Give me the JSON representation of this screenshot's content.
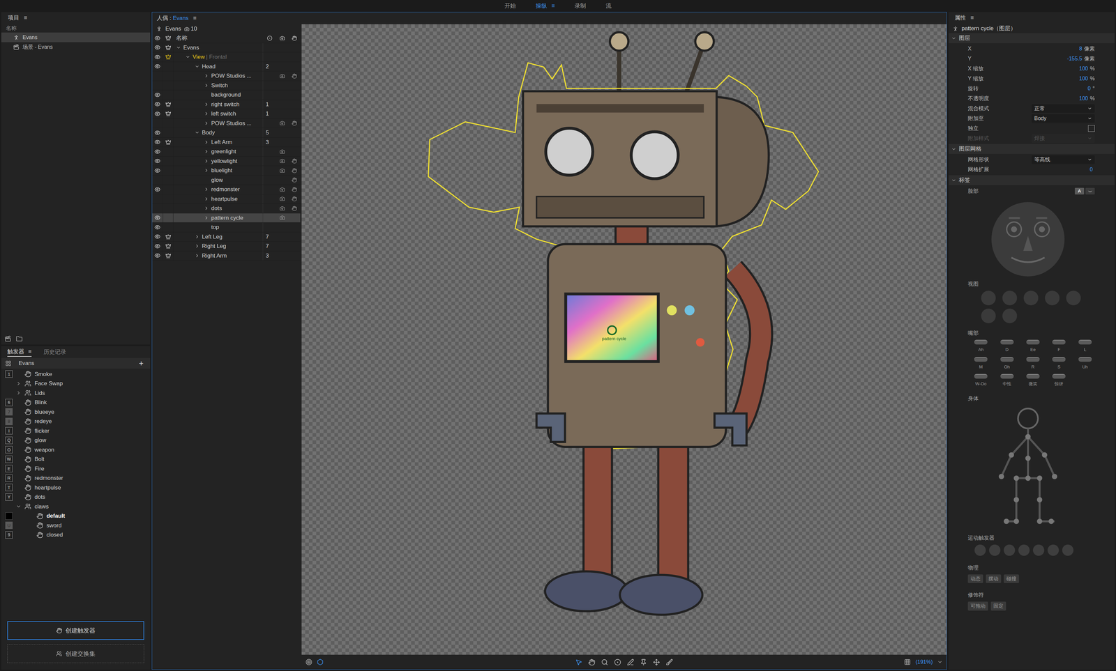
{
  "top_tabs": [
    {
      "label": "开始",
      "selected": false
    },
    {
      "label": "操纵",
      "selected": true
    },
    {
      "label": "录制",
      "selected": false
    },
    {
      "label": "流",
      "selected": false
    }
  ],
  "menu_glyph": "≡",
  "project": {
    "title": "项目",
    "column": "名称",
    "items": [
      {
        "label": "Evans",
        "kind": "puppet",
        "selected": true
      },
      {
        "label": "场景 - Evans",
        "kind": "scene",
        "selected": false
      }
    ]
  },
  "triggers": {
    "tabs": [
      {
        "label": "触发器",
        "selected": true
      },
      {
        "label": "历史记录",
        "selected": false
      }
    ],
    "puppet": "Evans",
    "add": "+",
    "items": [
      {
        "label": "Smoke",
        "kind": "trigger",
        "key": "1",
        "key_state": "outline",
        "child": false,
        "expanded": false
      },
      {
        "label": "Face Swap",
        "kind": "swapset",
        "key": "",
        "key_state": "none",
        "child": false,
        "expanded": false
      },
      {
        "label": "Lids",
        "kind": "swapset",
        "key": "",
        "key_state": "none",
        "child": false,
        "expanded": false
      },
      {
        "label": "Blink",
        "kind": "trigger",
        "key": "6",
        "key_state": "outline",
        "child": false,
        "expanded": false
      },
      {
        "label": "blueeye",
        "kind": "trigger",
        "key": "7",
        "key_state": "dim",
        "child": false,
        "expanded": false
      },
      {
        "label": "redeye",
        "kind": "trigger",
        "key": "8",
        "key_state": "dim",
        "child": false,
        "expanded": false
      },
      {
        "label": "flicker",
        "kind": "trigger",
        "key": "I",
        "key_state": "outline",
        "child": false,
        "expanded": false
      },
      {
        "label": "glow",
        "kind": "trigger",
        "key": "Q",
        "key_state": "outline",
        "child": false,
        "expanded": false
      },
      {
        "label": "weapon",
        "kind": "trigger",
        "key": "O",
        "key_state": "outline",
        "child": false,
        "expanded": false
      },
      {
        "label": "Bolt",
        "kind": "trigger",
        "key": "W",
        "key_state": "outline",
        "child": false,
        "expanded": false
      },
      {
        "label": "Fire",
        "kind": "trigger",
        "key": "E",
        "key_state": "outline",
        "child": false,
        "expanded": false
      },
      {
        "label": "redmonster",
        "kind": "trigger",
        "key": "R",
        "key_state": "outline",
        "child": false,
        "expanded": false
      },
      {
        "label": "heartpulse",
        "kind": "trigger",
        "key": "T",
        "key_state": "outline",
        "child": false,
        "expanded": false
      },
      {
        "label": "dots",
        "kind": "trigger",
        "key": "Y",
        "key_state": "outline",
        "child": false,
        "expanded": false
      },
      {
        "label": "claws",
        "kind": "swapset",
        "key": "",
        "key_state": "none",
        "child": false,
        "expanded": true
      },
      {
        "label": "default",
        "kind": "trigger",
        "key": "",
        "key_state": "filled",
        "child": true,
        "expanded": false,
        "default": true
      },
      {
        "label": "sword",
        "kind": "trigger",
        "key": "U",
        "key_state": "dim",
        "child": true,
        "expanded": false
      },
      {
        "label": "closed",
        "kind": "trigger",
        "key": "9",
        "key_state": "outline",
        "child": true,
        "expanded": false
      }
    ],
    "buttons": [
      {
        "label": "创建触发器",
        "kind": "primary"
      },
      {
        "label": "创建交换集",
        "kind": "dashed"
      }
    ]
  },
  "puppet_panel": {
    "title": "人偶",
    "separator": " : ",
    "puppet": "Evans",
    "root_label": "Evans",
    "root_count": "10",
    "header": "名称",
    "layers": [
      {
        "name": "Evans",
        "suffix": "",
        "count": "",
        "depth": 0,
        "arrow": "expanded",
        "visible": true,
        "crown": "white",
        "selected": false,
        "highlight": false,
        "tagged": false,
        "triggered": false
      },
      {
        "name": "View",
        "suffix": "| Frontal",
        "count": "",
        "depth": 1,
        "arrow": "expanded",
        "visible": true,
        "crown": "yellow",
        "selected": false,
        "highlight": true,
        "tagged": false,
        "triggered": false
      },
      {
        "name": "Head",
        "suffix": "",
        "count": "2",
        "depth": 2,
        "arrow": "expanded",
        "visible": true,
        "crown": "none",
        "selected": false,
        "highlight": false,
        "tagged": false,
        "triggered": false
      },
      {
        "name": "POW Studios ...",
        "suffix": "",
        "count": "",
        "depth": 3,
        "arrow": "collapsed",
        "visible": false,
        "crown": "none",
        "selected": false,
        "highlight": false,
        "tagged": true,
        "triggered": true
      },
      {
        "name": "Switch",
        "suffix": "",
        "count": "",
        "depth": 3,
        "arrow": "collapsed",
        "visible": false,
        "crown": "none",
        "selected": false,
        "highlight": false,
        "tagged": false,
        "triggered": false
      },
      {
        "name": "background",
        "suffix": "",
        "count": "",
        "depth": 3,
        "arrow": "none",
        "visible": true,
        "crown": "none",
        "selected": false,
        "highlight": false,
        "tagged": false,
        "triggered": false
      },
      {
        "name": "right switch",
        "suffix": "",
        "count": "1",
        "depth": 3,
        "arrow": "collapsed",
        "visible": true,
        "crown": "white",
        "selected": false,
        "highlight": false,
        "tagged": false,
        "triggered": false
      },
      {
        "name": "left switch",
        "suffix": "",
        "count": "1",
        "depth": 3,
        "arrow": "collapsed",
        "visible": true,
        "crown": "white",
        "selected": false,
        "highlight": false,
        "tagged": false,
        "triggered": false
      },
      {
        "name": "POW Studios ...",
        "suffix": "",
        "count": "",
        "depth": 3,
        "arrow": "collapsed",
        "visible": false,
        "crown": "none",
        "selected": false,
        "highlight": false,
        "tagged": true,
        "triggered": true
      },
      {
        "name": "Body",
        "suffix": "",
        "count": "5",
        "depth": 2,
        "arrow": "expanded",
        "visible": true,
        "crown": "none",
        "selected": false,
        "highlight": false,
        "tagged": false,
        "triggered": false
      },
      {
        "name": "Left Arm",
        "suffix": "",
        "count": "3",
        "depth": 3,
        "arrow": "collapsed",
        "visible": true,
        "crown": "white",
        "selected": false,
        "highlight": false,
        "tagged": false,
        "triggered": false
      },
      {
        "name": "greenlight",
        "suffix": "",
        "count": "",
        "depth": 3,
        "arrow": "collapsed",
        "visible": true,
        "crown": "none",
        "selected": false,
        "highlight": false,
        "tagged": true,
        "triggered": false
      },
      {
        "name": "yellowlight",
        "suffix": "",
        "count": "",
        "depth": 3,
        "arrow": "collapsed",
        "visible": true,
        "crown": "none",
        "selected": false,
        "highlight": false,
        "tagged": true,
        "triggered": true
      },
      {
        "name": "bluelight",
        "suffix": "",
        "count": "",
        "depth": 3,
        "arrow": "collapsed",
        "visible": true,
        "crown": "none",
        "selected": false,
        "highlight": false,
        "tagged": true,
        "triggered": true
      },
      {
        "name": "glow",
        "suffix": "",
        "count": "",
        "depth": 3,
        "arrow": "none",
        "visible": false,
        "crown": "none",
        "selected": false,
        "highlight": false,
        "tagged": false,
        "triggered": true
      },
      {
        "name": "redmonster",
        "suffix": "",
        "count": "",
        "depth": 3,
        "arrow": "collapsed",
        "visible": true,
        "crown": "none",
        "selected": false,
        "highlight": false,
        "tagged": true,
        "triggered": true
      },
      {
        "name": "heartpulse",
        "suffix": "",
        "count": "",
        "depth": 3,
        "arrow": "collapsed",
        "visible": false,
        "crown": "none",
        "selected": false,
        "highlight": false,
        "tagged": true,
        "triggered": true
      },
      {
        "name": "dots",
        "suffix": "",
        "count": "",
        "depth": 3,
        "arrow": "collapsed",
        "visible": false,
        "crown": "none",
        "selected": false,
        "highlight": false,
        "tagged": true,
        "triggered": true
      },
      {
        "name": "pattern cycle",
        "suffix": "",
        "count": "",
        "depth": 3,
        "arrow": "collapsed",
        "visible": true,
        "crown": "none",
        "selected": true,
        "highlight": false,
        "tagged": true,
        "triggered": false
      },
      {
        "name": "top",
        "suffix": "",
        "count": "",
        "depth": 3,
        "arrow": "none",
        "visible": true,
        "crown": "none",
        "selected": false,
        "highlight": false,
        "tagged": false,
        "triggered": false
      },
      {
        "name": "Left Leg",
        "suffix": "",
        "count": "7",
        "depth": 2,
        "arrow": "collapsed",
        "visible": true,
        "crown": "white",
        "selected": false,
        "highlight": false,
        "tagged": false,
        "triggered": false
      },
      {
        "name": "Right Leg",
        "suffix": "",
        "count": "7",
        "depth": 2,
        "arrow": "collapsed",
        "visible": true,
        "crown": "white",
        "selected": false,
        "highlight": false,
        "tagged": false,
        "triggered": false
      },
      {
        "name": "Right Arm",
        "suffix": "",
        "count": "3",
        "depth": 2,
        "arrow": "collapsed",
        "visible": true,
        "crown": "white",
        "selected": false,
        "highlight": false,
        "tagged": false,
        "triggered": false
      }
    ]
  },
  "canvas": {
    "handle_label": "pattern cycle",
    "zoom": "(191%)",
    "left_tools": [
      {
        "selected": false
      },
      {
        "selected": true
      }
    ],
    "tools": [
      {
        "selected": true
      },
      {
        "selected": false
      },
      {
        "selected": false
      },
      {
        "selected": false
      },
      {
        "selected": false
      },
      {
        "selected": false
      },
      {
        "selected": false
      },
      {
        "selected": false
      }
    ]
  },
  "properties": {
    "title": "属性",
    "layer_title": "pattern cycle（图层）",
    "sections": [
      {
        "title": "图层",
        "expanded": true,
        "rows": [
          {
            "label": "X",
            "kind": "number",
            "value": "8",
            "unit": "像素",
            "disabled": false
          },
          {
            "label": "Y",
            "kind": "number",
            "value": "-155.5",
            "unit": "像素",
            "disabled": false
          },
          {
            "label": "X 缩放",
            "kind": "number",
            "value": "100",
            "unit": "%",
            "disabled": false
          },
          {
            "label": "Y 缩放",
            "kind": "number",
            "value": "100",
            "unit": "%",
            "disabled": false
          },
          {
            "label": "旋转",
            "kind": "number",
            "value": "0",
            "unit": "°",
            "disabled": false
          },
          {
            "label": "不透明度",
            "kind": "number",
            "value": "100",
            "unit": "%",
            "disabled": false
          },
          {
            "label": "混合模式",
            "kind": "select",
            "value": "正常",
            "disabled": false
          },
          {
            "label": "附加至",
            "kind": "select",
            "value": "Body",
            "disabled": false
          },
          {
            "label": "独立",
            "kind": "checkbox",
            "checked": false,
            "disabled": false
          },
          {
            "label": "附加样式",
            "kind": "select",
            "value": "焊接",
            "disabled": true
          }
        ]
      },
      {
        "title": "图层网格",
        "expanded": true,
        "rows": [
          {
            "label": "网格形状",
            "kind": "select",
            "value": "等高线",
            "disabled": false
          },
          {
            "label": "网格扩展",
            "kind": "number",
            "value": "0",
            "unit": "",
            "disabled": false
          }
        ]
      }
    ],
    "tags": {
      "title": "标签",
      "expanded": true,
      "face": "脸部",
      "face_modes": [
        {
          "kind": "letter",
          "label": "A",
          "selected": true
        },
        {
          "kind": "face",
          "label": "",
          "selected": false
        }
      ],
      "views": {
        "label": "视图",
        "items": [
          {
            "selected": false
          },
          {
            "selected": false
          },
          {
            "selected": false
          },
          {
            "selected": false
          },
          {
            "selected": false
          },
          {
            "selected": false
          },
          {
            "selected": false
          }
        ]
      },
      "mouth": {
        "label": "嘴部",
        "items": [
          "Ah",
          "D",
          "Ee",
          "F",
          "L",
          "M",
          "Oh",
          "R",
          "S",
          "Uh",
          "W-Oo",
          "中性",
          "微笑",
          "惊讶"
        ]
      },
      "body": "身体",
      "motion": {
        "label": "运动触发器",
        "items": [
          {
            "selected": false
          },
          {
            "selected": false
          },
          {
            "selected": false
          },
          {
            "selected": false
          },
          {
            "selected": false
          },
          {
            "selected": false
          },
          {
            "selected": false
          }
        ]
      },
      "physics": {
        "label": "物理",
        "items": [
          "动态",
          "摆动",
          "碰撞"
        ]
      },
      "modifiers": {
        "label": "修饰符",
        "items": [
          "可拖动",
          "固定"
        ]
      }
    }
  }
}
